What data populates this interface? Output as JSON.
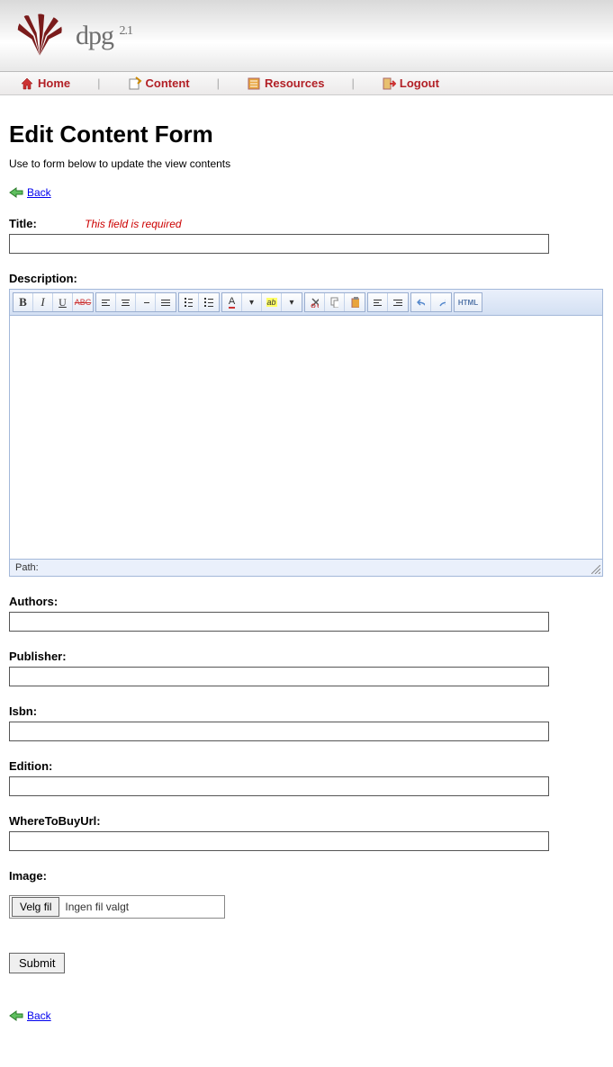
{
  "app": {
    "name": "dpg",
    "version": "2.1"
  },
  "nav": {
    "home": "Home",
    "content": "Content",
    "resources": "Resources",
    "logout": "Logout"
  },
  "page": {
    "heading": "Edit Content Form",
    "intro": "Use to form below to update the view contents",
    "back": "Back"
  },
  "form": {
    "title_label": "Title:",
    "title_error": "This field is required",
    "title_value": "",
    "description_label": "Description:",
    "authors_label": "Authors:",
    "authors_value": "",
    "publisher_label": "Publisher:",
    "publisher_value": "",
    "isbn_label": "Isbn:",
    "isbn_value": "",
    "edition_label": "Edition:",
    "edition_value": "",
    "wtb_label": "WhereToBuyUrl:",
    "wtb_value": "",
    "image_label": "Image:",
    "file_button": "Velg fil",
    "file_status": "Ingen fil valgt",
    "submit": "Submit"
  },
  "editor": {
    "path_label": "Path:",
    "html_label": "HTML"
  }
}
